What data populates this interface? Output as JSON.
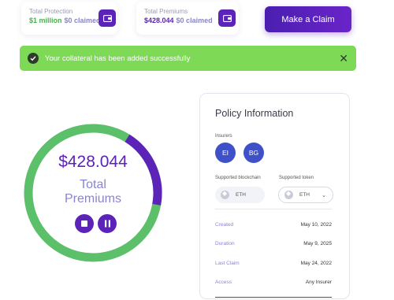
{
  "stats": [
    {
      "label": "Total Protection",
      "value": "$1 million",
      "claimed": "$0 claimed",
      "icon": "wallet-icon"
    },
    {
      "label": "Total Premiums",
      "value": "$428.044",
      "claimed": "$0 claimed",
      "icon": "wallet-icon"
    }
  ],
  "claim_button": "Make a Claim",
  "alert": {
    "message": "Your collateral has been added successfully",
    "icon": "check-circle-icon",
    "close_icon": "close-icon"
  },
  "premium": {
    "amount": "$428.044",
    "label_line1": "Total",
    "label_line2": "Premiums",
    "progress": 0.81
  },
  "controls": {
    "stop_icon": "stop-icon",
    "pause_icon": "pause-icon"
  },
  "policy": {
    "title": "Policy Information",
    "insurers_label": "Insurers",
    "insurers": [
      "EI",
      "BG"
    ],
    "blockchain_label": "Supported blockchain",
    "blockchain_value": "ETH",
    "token_label": "Supported token",
    "token_value": "ETH",
    "rows": [
      {
        "key": "Created",
        "value": "May 10, 2022"
      },
      {
        "key": "Duration",
        "value": "May 9, 2025"
      },
      {
        "key": "Last Claim",
        "value": "May 24, 2022"
      },
      {
        "key": "Access",
        "value": "Any Insurer"
      }
    ]
  },
  "colors": {
    "primary": "#5b23b8",
    "success": "#7ed957",
    "ring_green": "#5cbf6a",
    "ring_purple": "#5b23b8"
  }
}
